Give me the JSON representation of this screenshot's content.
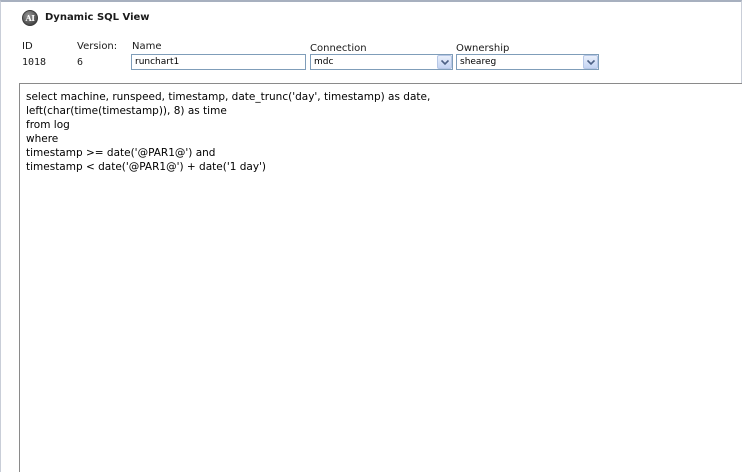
{
  "window": {
    "title": "Dynamic SQL View",
    "logo_icon": "ai-logo-icon"
  },
  "fields": {
    "id_label": "ID",
    "id_value": "1018",
    "version_label": "Version:",
    "version_value": "6",
    "name_label": "Name",
    "name_value": "runchart1",
    "connection_label": "Connection",
    "connection_value": "mdc",
    "ownership_label": "Ownership",
    "ownership_value": "sheareg"
  },
  "editor": {
    "lines": [
      "select machine, runspeed, timestamp, date_trunc('day', timestamp) as date,",
      "left(char(time(timestamp)), 8) as time",
      "from log",
      "where",
      "timestamp >= date('@PAR1@') and",
      "timestamp < date('@PAR1@') + date('1 day')"
    ]
  },
  "colors": {
    "input_border": "#7f9db9",
    "dropdown_button": "#c4d4f3",
    "dropdown_arrow": "#4d6185"
  }
}
